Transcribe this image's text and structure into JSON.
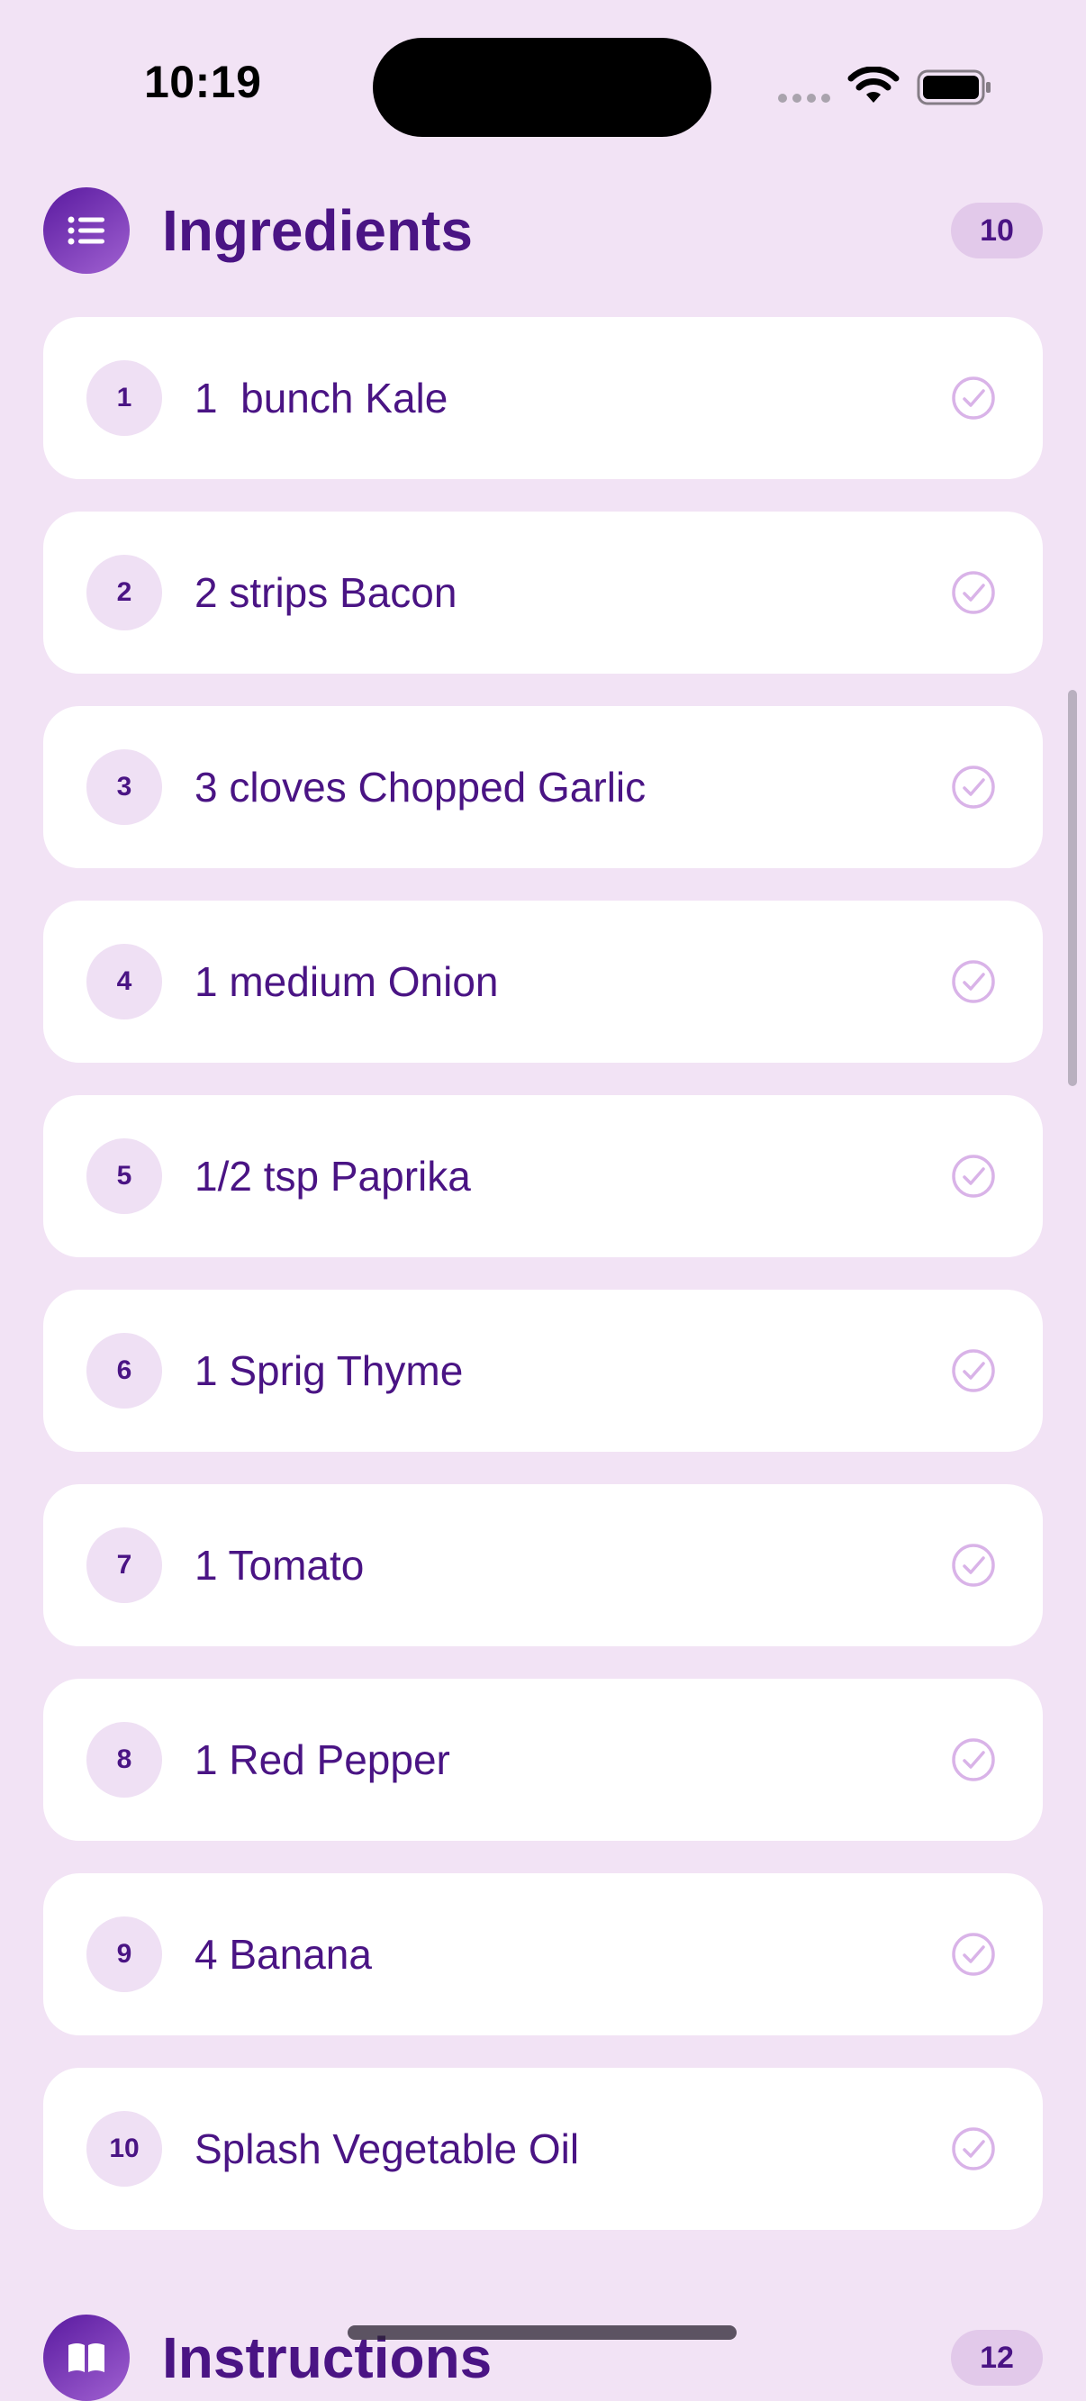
{
  "status_bar": {
    "time": "10:19"
  },
  "ingredients_section": {
    "title": "Ingredients",
    "count": "10",
    "icon": "list-icon",
    "items": [
      {
        "number": "1",
        "text": "1  bunch Kale"
      },
      {
        "number": "2",
        "text": "2 strips Bacon"
      },
      {
        "number": "3",
        "text": "3 cloves Chopped Garlic"
      },
      {
        "number": "4",
        "text": "1 medium Onion"
      },
      {
        "number": "5",
        "text": "1/2 tsp Paprika"
      },
      {
        "number": "6",
        "text": "1 Sprig Thyme"
      },
      {
        "number": "7",
        "text": "1 Tomato"
      },
      {
        "number": "8",
        "text": "1 Red Pepper"
      },
      {
        "number": "9",
        "text": "4 Banana"
      },
      {
        "number": "10",
        "text": "Splash Vegetable Oil"
      }
    ]
  },
  "instructions_section": {
    "title": "Instructions",
    "count": "12",
    "icon": "book-icon"
  },
  "colors": {
    "background": "#f2e3f5",
    "accent": "#4a1484",
    "card": "#ffffff",
    "badge": "#e2c9ea",
    "check": "#d9b3e8"
  }
}
